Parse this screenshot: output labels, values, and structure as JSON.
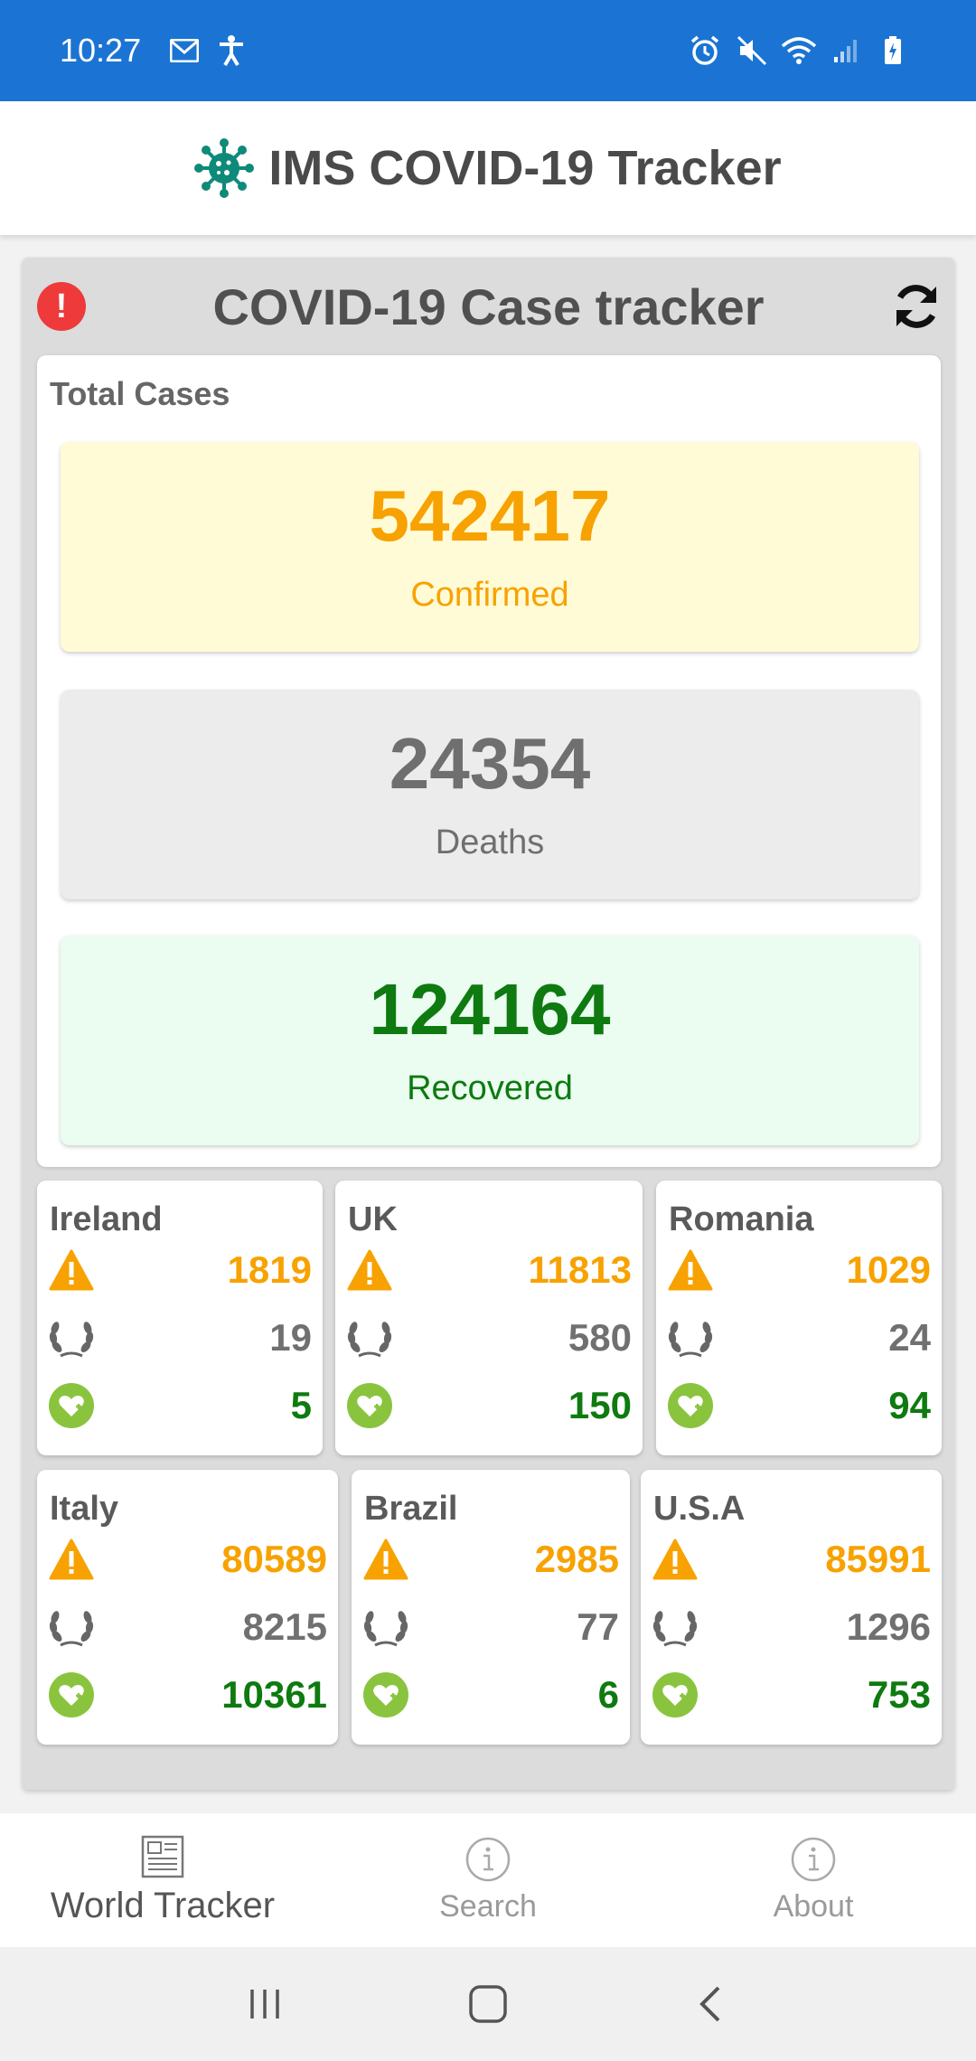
{
  "status_bar": {
    "time": "10:27"
  },
  "app": {
    "title": "IMS COVID-19 Tracker"
  },
  "tracker": {
    "title": "COVID-19 Case tracker",
    "total_label": "Total Cases",
    "confirmed": {
      "value": "542417",
      "label": "Confirmed"
    },
    "deaths": {
      "value": "24354",
      "label": "Deaths"
    },
    "recovered": {
      "value": "124164",
      "label": "Recovered"
    }
  },
  "countries": [
    {
      "name": "Ireland",
      "confirmed": "1819",
      "deaths": "19",
      "recovered": "5"
    },
    {
      "name": "UK",
      "confirmed": "11813",
      "deaths": "580",
      "recovered": "150"
    },
    {
      "name": "Romania",
      "confirmed": "1029",
      "deaths": "24",
      "recovered": "94"
    },
    {
      "name": "Italy",
      "confirmed": "80589",
      "deaths": "8215",
      "recovered": "10361"
    },
    {
      "name": "Brazil",
      "confirmed": "2985",
      "deaths": "77",
      "recovered": "6"
    },
    {
      "name": "U.S.A",
      "confirmed": "85991",
      "deaths": "1296",
      "recovered": "753"
    }
  ],
  "bottom_nav": {
    "world_tracker": "World Tracker",
    "search": "Search",
    "about": "About"
  },
  "colors": {
    "status_bar": "#1b74d3",
    "confirmed": "#f7a200",
    "deaths": "#707070",
    "recovered": "#0e7a10",
    "alert": "#ee3a3a"
  }
}
